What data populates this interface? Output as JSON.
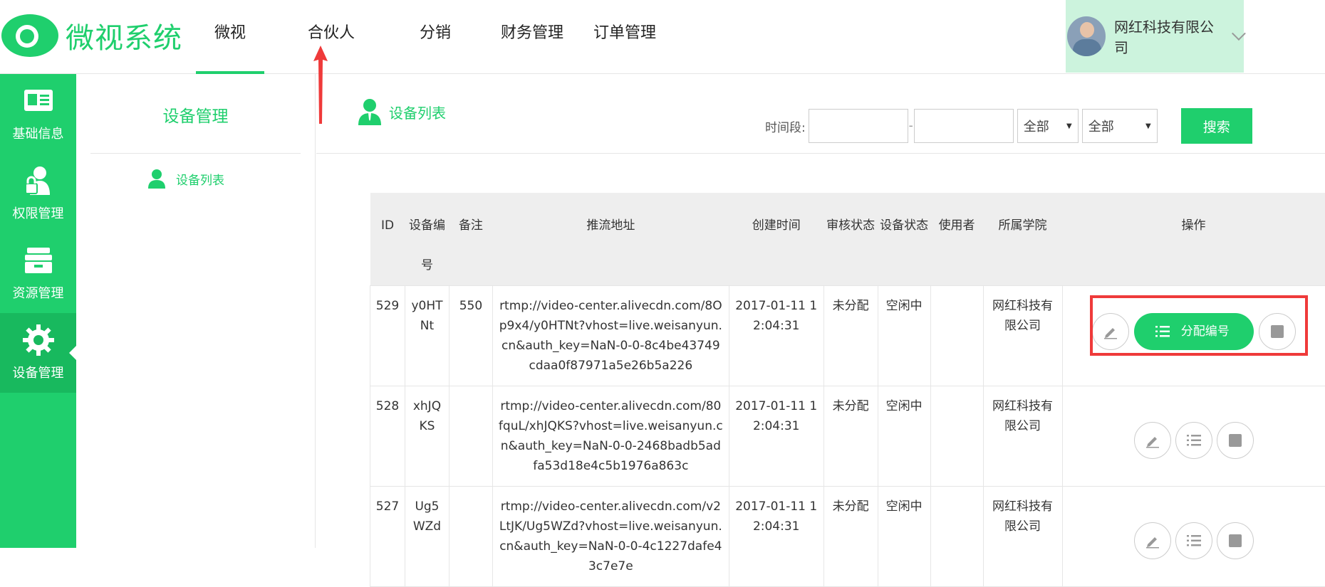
{
  "brand": {
    "name": "微视系统",
    "color": "#1fcf6d"
  },
  "nav": [
    "微视",
    "合伙人",
    "分销",
    "财务管理",
    "订单管理"
  ],
  "user": {
    "company": "网红科技有限公司"
  },
  "sidebar": [
    {
      "label": "基础信息",
      "icon": "id-card-icon"
    },
    {
      "label": "权限管理",
      "icon": "user-lock-icon"
    },
    {
      "label": "资源管理",
      "icon": "archive-icon"
    },
    {
      "label": "设备管理",
      "icon": "gear-icon"
    }
  ],
  "subnav": {
    "title": "设备管理",
    "item": "设备列表"
  },
  "main": {
    "title": "设备列表"
  },
  "filters": {
    "time_label": "时间段:",
    "dash": "-",
    "select1": "全部",
    "select2": "全部",
    "search": "搜索"
  },
  "table": {
    "headers": [
      "ID",
      "设备编号",
      "备注",
      "推流地址",
      "创建时间",
      "审核状态",
      "设备状态",
      "使用者",
      "所属学院",
      "操作"
    ],
    "assign_label": "分配编号",
    "rows": [
      {
        "id": "529",
        "code": "y0HTNt",
        "note": "550",
        "url": "rtmp://video-center.alivecdn.com/8Op9x4/y0HTNt?vhost=live.weisanyun.cn&auth_key=NaN-0-0-8c4be43749cdaa0f87971a5e26b5a226",
        "created": "2017-01-11 12:04:31",
        "review": "未分配",
        "state": "空闲中",
        "user": "",
        "college": "网红科技有限公司"
      },
      {
        "id": "528",
        "code": "xhJQKS",
        "note": "",
        "url": "rtmp://video-center.alivecdn.com/80fquL/xhJQKS?vhost=live.weisanyun.cn&auth_key=NaN-0-0-2468badb5adfa53d18e4c5b1976a863c",
        "created": "2017-01-11 12:04:31",
        "review": "未分配",
        "state": "空闲中",
        "user": "",
        "college": "网红科技有限公司"
      },
      {
        "id": "527",
        "code": "Ug5WZd",
        "note": "",
        "url": "rtmp://video-center.alivecdn.com/v2LtJK/Ug5WZd?vhost=live.weisanyun.cn&auth_key=NaN-0-0-4c1227dafe43c7e7e",
        "created": "2017-01-11 12:04:31",
        "review": "未分配",
        "state": "空闲中",
        "user": "",
        "college": "网红科技有限公司"
      }
    ]
  }
}
